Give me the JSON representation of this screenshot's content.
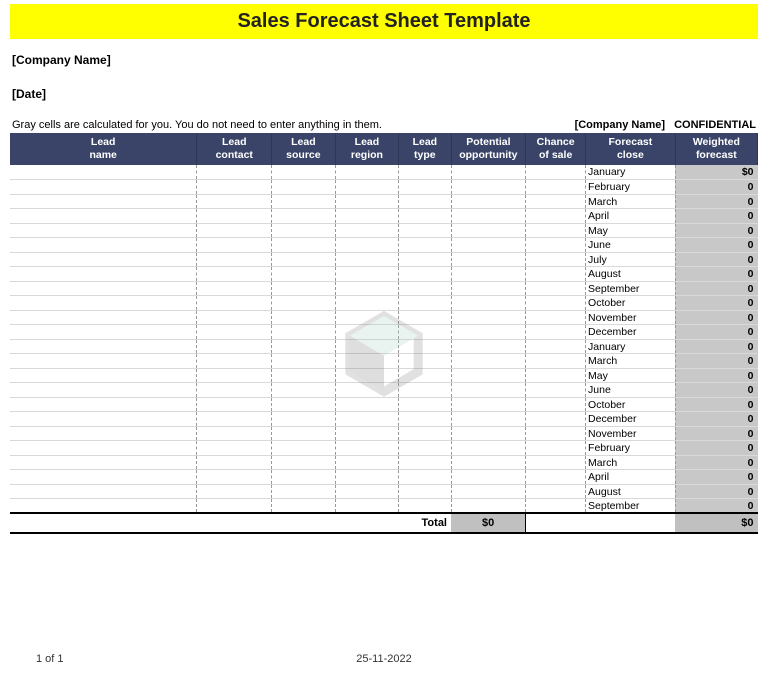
{
  "title": "Sales Forecast Sheet Template",
  "company_name_placeholder": "[Company Name]",
  "date_placeholder": "[Date]",
  "hint_text": "Gray cells are calculated for you. You do not need to enter anything in them.",
  "confidential_company": "[Company Name]",
  "confidential_label": "CONFIDENTIAL",
  "columns": {
    "lead_name": "Lead\nname",
    "lead_contact": "Lead\ncontact",
    "lead_source": "Lead\nsource",
    "lead_region": "Lead\nregion",
    "lead_type": "Lead\ntype",
    "potential_opportunity": "Potential\nopportunity",
    "chance_of_sale": "Chance\nof sale",
    "forecast_close": "Forecast\nclose",
    "weighted_forecast": "Weighted\nforecast"
  },
  "rows": [
    {
      "forecast_close": "January",
      "weighted": "$0"
    },
    {
      "forecast_close": "February",
      "weighted": "0"
    },
    {
      "forecast_close": "March",
      "weighted": "0"
    },
    {
      "forecast_close": "April",
      "weighted": "0"
    },
    {
      "forecast_close": "May",
      "weighted": "0"
    },
    {
      "forecast_close": "June",
      "weighted": "0"
    },
    {
      "forecast_close": "July",
      "weighted": "0"
    },
    {
      "forecast_close": "August",
      "weighted": "0"
    },
    {
      "forecast_close": "September",
      "weighted": "0"
    },
    {
      "forecast_close": "October",
      "weighted": "0"
    },
    {
      "forecast_close": "November",
      "weighted": "0"
    },
    {
      "forecast_close": "December",
      "weighted": "0"
    },
    {
      "forecast_close": "January",
      "weighted": "0"
    },
    {
      "forecast_close": "March",
      "weighted": "0"
    },
    {
      "forecast_close": "May",
      "weighted": "0"
    },
    {
      "forecast_close": "June",
      "weighted": "0"
    },
    {
      "forecast_close": "October",
      "weighted": "0"
    },
    {
      "forecast_close": "December",
      "weighted": "0"
    },
    {
      "forecast_close": "November",
      "weighted": "0"
    },
    {
      "forecast_close": "February",
      "weighted": "0"
    },
    {
      "forecast_close": "March",
      "weighted": "0"
    },
    {
      "forecast_close": "April",
      "weighted": "0"
    },
    {
      "forecast_close": "August",
      "weighted": "0"
    },
    {
      "forecast_close": "September",
      "weighted": "0"
    }
  ],
  "total": {
    "label": "Total",
    "opportunity_sum": "$0",
    "weighted_sum": "$0"
  },
  "footer": {
    "page": "1 of 1",
    "date": "25-11-2022"
  }
}
